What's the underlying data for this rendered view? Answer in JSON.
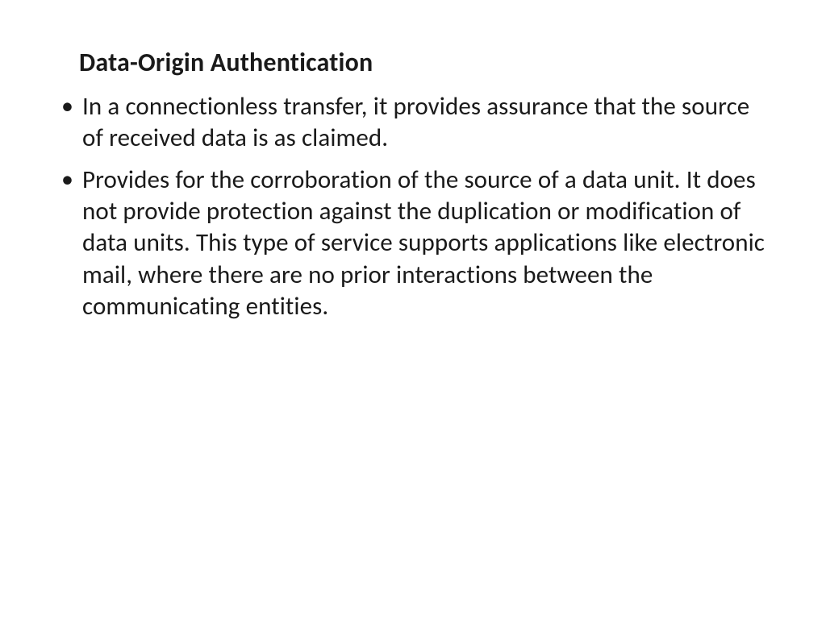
{
  "slide": {
    "title": "Data-Origin Authentication",
    "bullets": [
      "In a connectionless transfer, it provides assurance that the source of received data is as claimed.",
      "Provides for the corroboration of the source of a data unit. It does not provide protection against the duplication or modification of data units. This type of service supports applications like electronic mail, where there are no prior interactions between the communicating entities."
    ]
  }
}
